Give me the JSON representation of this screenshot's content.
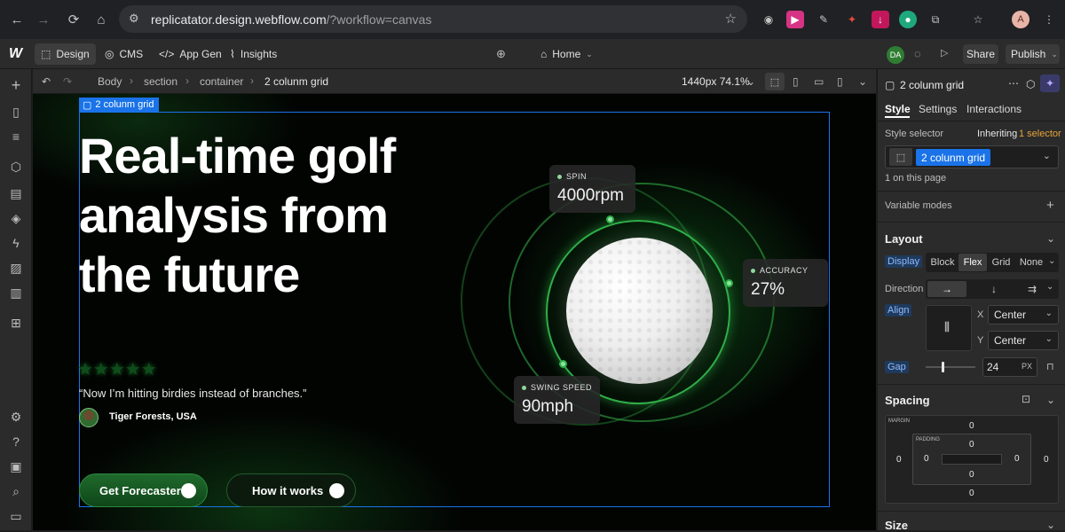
{
  "browser": {
    "url_host": "replicatator.design.webflow.com",
    "url_path": "/?workflow=canvas",
    "profile_initial": "A"
  },
  "toolbar": {
    "tabs": [
      {
        "label": "Design"
      },
      {
        "label": "CMS"
      },
      {
        "label": "App Gen"
      },
      {
        "label": "Insights"
      }
    ],
    "page_label": "Home",
    "user_initials": "DA",
    "share_label": "Share",
    "publish_label": "Publish"
  },
  "breadcrumb": {
    "items": [
      "Body",
      "section",
      "container",
      "2 colunm grid"
    ],
    "viewport": "1440px 74.1%"
  },
  "canvas": {
    "selection_label": "2 colunm grid",
    "hero_title": "Real-time golf analysis from the future",
    "stars": "★★★★★",
    "quote": "“Now I’m hitting birdies instead of branches.”",
    "author": "Tiger Forests, USA",
    "cta_primary": "Get Forecaster",
    "cta_secondary": "How it works",
    "stats": [
      {
        "label": "SPIN",
        "value": "4000rpm"
      },
      {
        "label": "ACCURACY",
        "value": "27%"
      },
      {
        "label": "SWING SPEED",
        "value": "90mph"
      }
    ]
  },
  "panel": {
    "element_name": "2 colunm grid",
    "tabs": [
      "Style",
      "Settings",
      "Interactions"
    ],
    "style_selector_label": "Style selector",
    "inheriting_label": "Inheriting",
    "inheriting_count": "1 selector",
    "class_chip": "2 colunm grid",
    "on_page": "1 on this page",
    "variable_modes": "Variable modes",
    "layout": {
      "heading": "Layout",
      "display_label": "Display",
      "display_options": [
        "Block",
        "Flex",
        "Grid",
        "None"
      ],
      "display_active": "Flex",
      "direction_label": "Direction",
      "align_label": "Align",
      "x_label": "X",
      "x_value": "Center",
      "y_label": "Y",
      "y_value": "Center",
      "gap_label": "Gap",
      "gap_value": "24",
      "gap_unit": "PX"
    },
    "spacing": {
      "heading": "Spacing",
      "margin_label": "MARGIN",
      "padding_label": "PADDING",
      "margin_top": "0",
      "margin_right": "0",
      "margin_bottom": "0",
      "margin_left": "0",
      "padding_top": "0",
      "padding_right": "0",
      "padding_bottom": "0",
      "padding_left": "0"
    },
    "size_heading": "Size"
  },
  "colors": {
    "accent_blue": "#1a73e8",
    "brand_green": "#2fae48",
    "panel_bg": "#2b2b2b"
  }
}
